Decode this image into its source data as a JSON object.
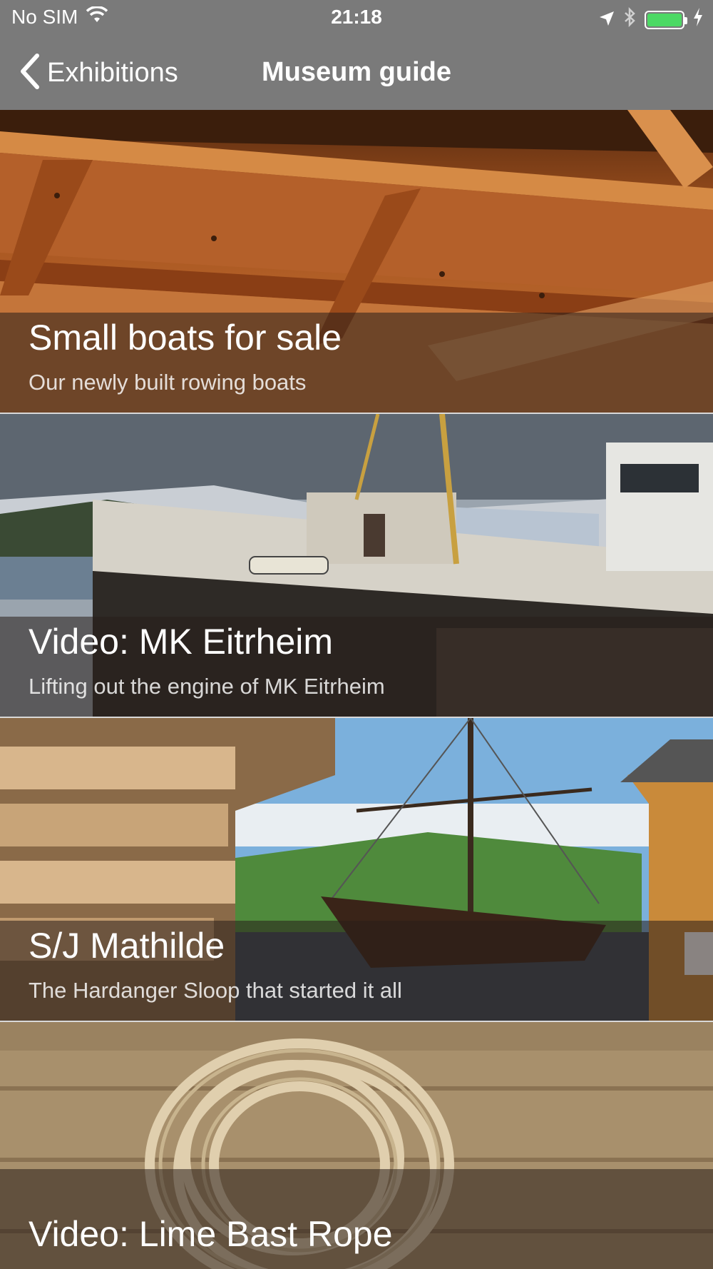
{
  "status_bar": {
    "carrier": "No SIM",
    "time": "21:18",
    "battery_level": 1.0,
    "battery_color": "#4cd964"
  },
  "nav": {
    "back_label": "Exhibitions",
    "title": "Museum guide",
    "bar_color": "#7a7a7a"
  },
  "cards": [
    {
      "title": "Small boats for sale",
      "subtitle": "Our newly built rowing boats"
    },
    {
      "title": "Video: MK Eitrheim",
      "subtitle": "Lifting out the engine of MK Eitrheim"
    },
    {
      "title": "S/J Mathilde",
      "subtitle": "The Hardanger Sloop that started it all"
    },
    {
      "title": "Video: Lime Bast Rope",
      "subtitle": ""
    }
  ]
}
